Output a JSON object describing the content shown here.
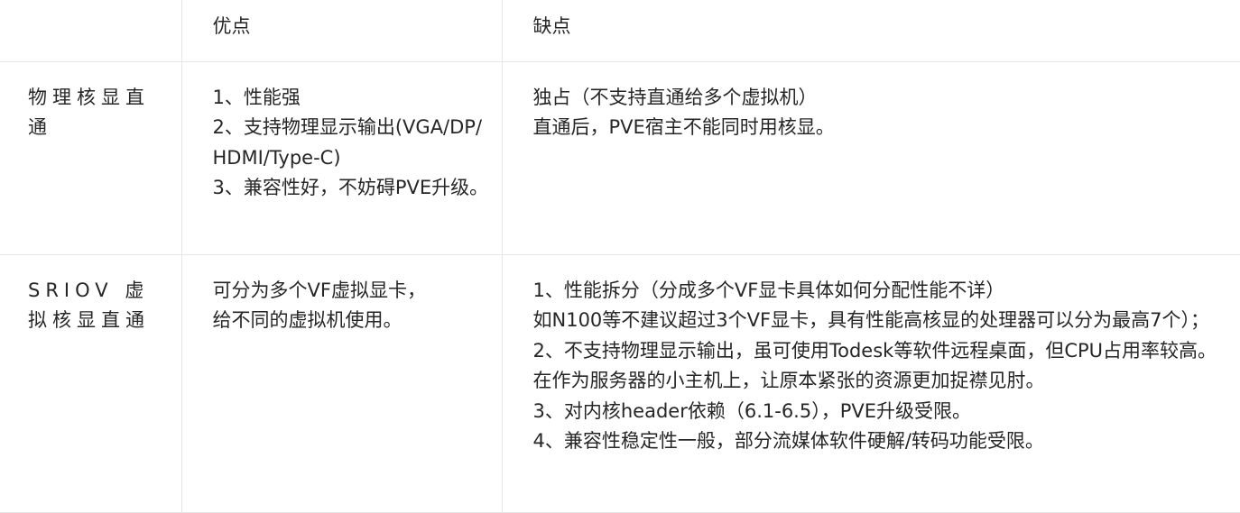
{
  "table": {
    "headers": [
      "",
      "优点",
      "缺点"
    ],
    "rows": [
      {
        "feature": "物理核显直通",
        "pros": [
          "1、性能强",
          "2、支持物理显示输出(VGA/DP/HDMI/Type-C)",
          "3、兼容性好，不妨碍PVE升级。"
        ],
        "cons": [
          "独占（不支持直通给多个虚拟机）",
          "直通后，PVE宿主不能同时用核显。"
        ]
      },
      {
        "feature": "SRIOV 虚 拟核显直通",
        "pros": [
          "可分为多个VF虚拟显卡，",
          "给不同的虚拟机使用。"
        ],
        "cons": [
          "1、性能拆分（分成多个VF显卡具体如何分配性能不详）",
          "如N100等不建议超过3个VF显卡，具有性能高核显的处理器可以分为最高7个）；",
          "2、不支持物理显示输出，虽可使用Todesk等软件远程桌面，但CPU占用率较高。在作为服务器的小主机上，让原本紧张的资源更加捉襟见肘。",
          "3、对内核header依赖（6.1-6.5），PVE升级受限。",
          "4、兼容性稳定性一般，部分流媒体软件硬解/转码功能受限。"
        ]
      }
    ]
  }
}
